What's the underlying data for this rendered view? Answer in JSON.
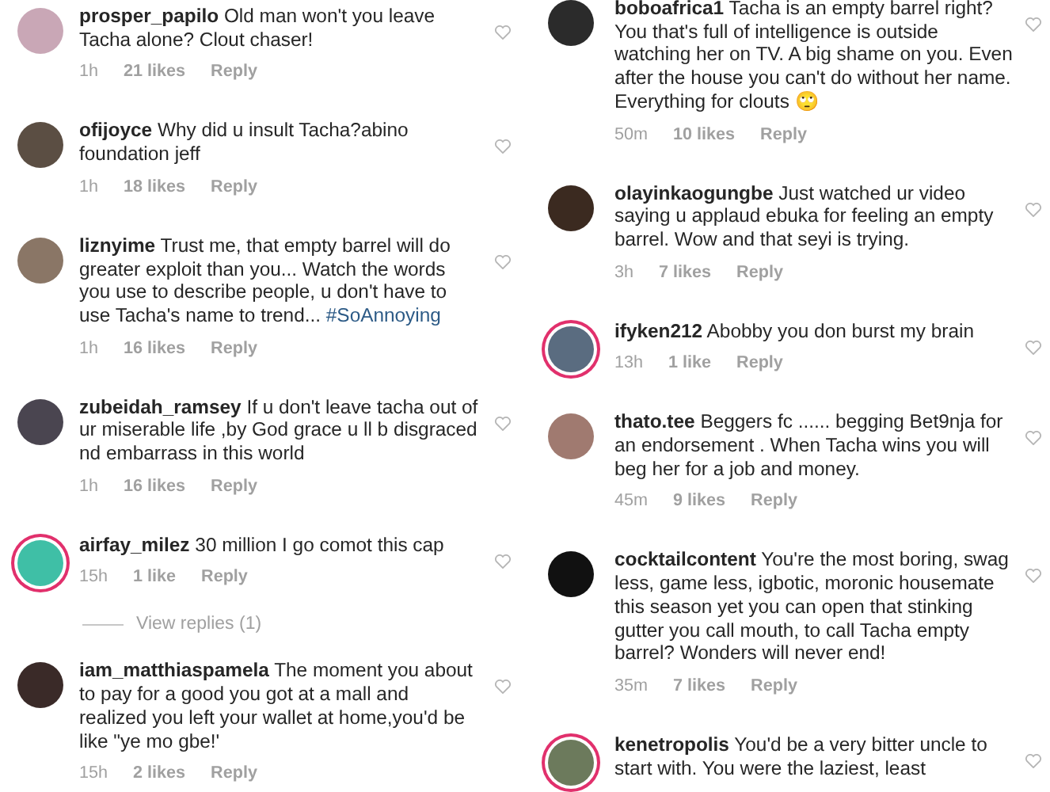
{
  "columns": [
    {
      "comments": [
        {
          "user": "prosper_papilo",
          "text": "Old man won't you leave Tacha alone? Clout chaser!",
          "time": "1h",
          "likes": "21 likes",
          "reply": "Reply",
          "story": false
        },
        {
          "user": "ofijoyce",
          "text": "Why did u insult Tacha?abino foundation jeff",
          "time": "1h",
          "likes": "18 likes",
          "reply": "Reply",
          "story": false
        },
        {
          "user": "liznyime",
          "text": "Trust me, that empty barrel will do greater exploit than you... Watch the words you use to describe people, u don't have to use Tacha's name to trend...",
          "tag": "#SoAnnoying",
          "time": "1h",
          "likes": "16 likes",
          "reply": "Reply",
          "story": false
        },
        {
          "user": "zubeidah_ramsey",
          "text": "If u don't leave tacha out of ur miserable life ,by God grace u ll b disgraced nd embarrass in this world",
          "time": "1h",
          "likes": "16 likes",
          "reply": "Reply",
          "story": false
        },
        {
          "user": "airfay_milez",
          "text": "30 million I go comot this cap",
          "time": "15h",
          "likes": "1 like",
          "reply": "Reply",
          "story": true,
          "view_replies": "View replies (1)"
        },
        {
          "user": "iam_matthiaspamela",
          "text": "The moment you about to pay for a good you got at a mall and realized you left your wallet at home,you'd be like \"ye mo gbe!'",
          "time": "15h",
          "likes": "2 likes",
          "reply": "Reply",
          "story": false
        }
      ]
    },
    {
      "comments": [
        {
          "user": "boboafrica1",
          "text": "Tacha is an empty barrel right? You that's full of intelligence is outside watching her on TV. A big shame on you. Even after the house you can't do without her name. Everything for clouts 🙄",
          "time": "50m",
          "likes": "10 likes",
          "reply": "Reply",
          "story": false
        },
        {
          "user": "olayinkaogungbe",
          "text": "Just watched ur video saying u applaud ebuka for feeling an empty barrel. Wow and that seyi is trying.",
          "time": "3h",
          "likes": "7 likes",
          "reply": "Reply",
          "story": false
        },
        {
          "user": "ifyken212",
          "text": "Abobby you don burst my brain",
          "time": "13h",
          "likes": "1 like",
          "reply": "Reply",
          "story": true
        },
        {
          "user": "thato.tee",
          "text": "Beggers fc ...... begging Bet9nja for an endorsement . When Tacha wins you will beg her for a job and money.",
          "time": "45m",
          "likes": "9 likes",
          "reply": "Reply",
          "story": false
        },
        {
          "user": "cocktailcontent",
          "text": "You're the most boring, swag less, game less, igbotic, moronic housemate this season yet you can open that stinking gutter you call mouth, to call Tacha empty barrel? Wonders will never end!",
          "time": "35m",
          "likes": "7 likes",
          "reply": "Reply",
          "story": false
        },
        {
          "user": "kenetropolis",
          "text": "You'd be a very bitter uncle to start with. You were the laziest, least",
          "story": true
        }
      ]
    }
  ]
}
